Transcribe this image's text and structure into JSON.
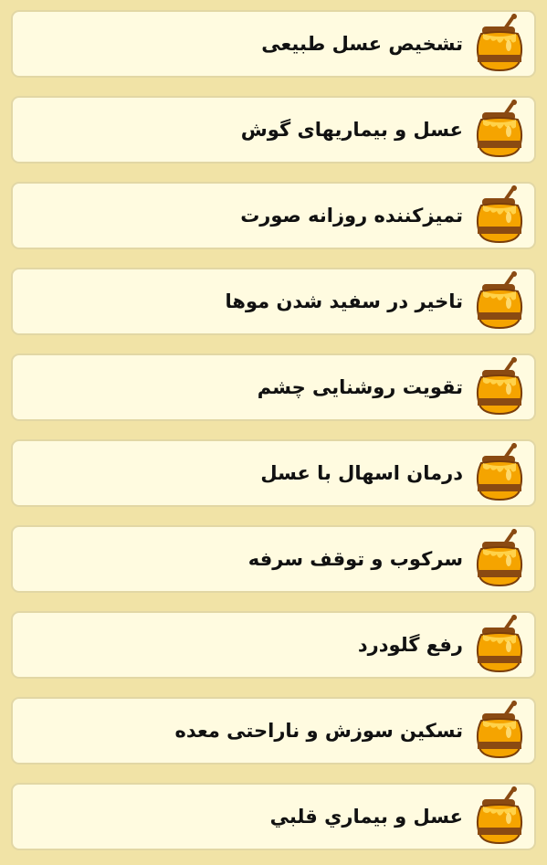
{
  "icon": "honey-jar-icon",
  "colors": {
    "background": "#f1e3a6",
    "item_background": "#fffbe0",
    "item_border": "#e2d7a5",
    "honey": "#f5a400",
    "band": "#8a4a12",
    "text": "#111111"
  },
  "items": [
    {
      "label": "تشخیص عسل طبیعی"
    },
    {
      "label": "عسل و بیماریهای گوش"
    },
    {
      "label": "تمیزکننده روزانه صورت"
    },
    {
      "label": "تاخیر در سفید شدن موها"
    },
    {
      "label": "تقویت روشنایی چشم"
    },
    {
      "label": "درمان اسهال با عسل"
    },
    {
      "label": "سرکوب و توقف سرفه"
    },
    {
      "label": "رفع گلودرد"
    },
    {
      "label": "تسکین سوزش و ناراحتی معده"
    },
    {
      "label": "عسل و بیماري قلبي"
    }
  ]
}
